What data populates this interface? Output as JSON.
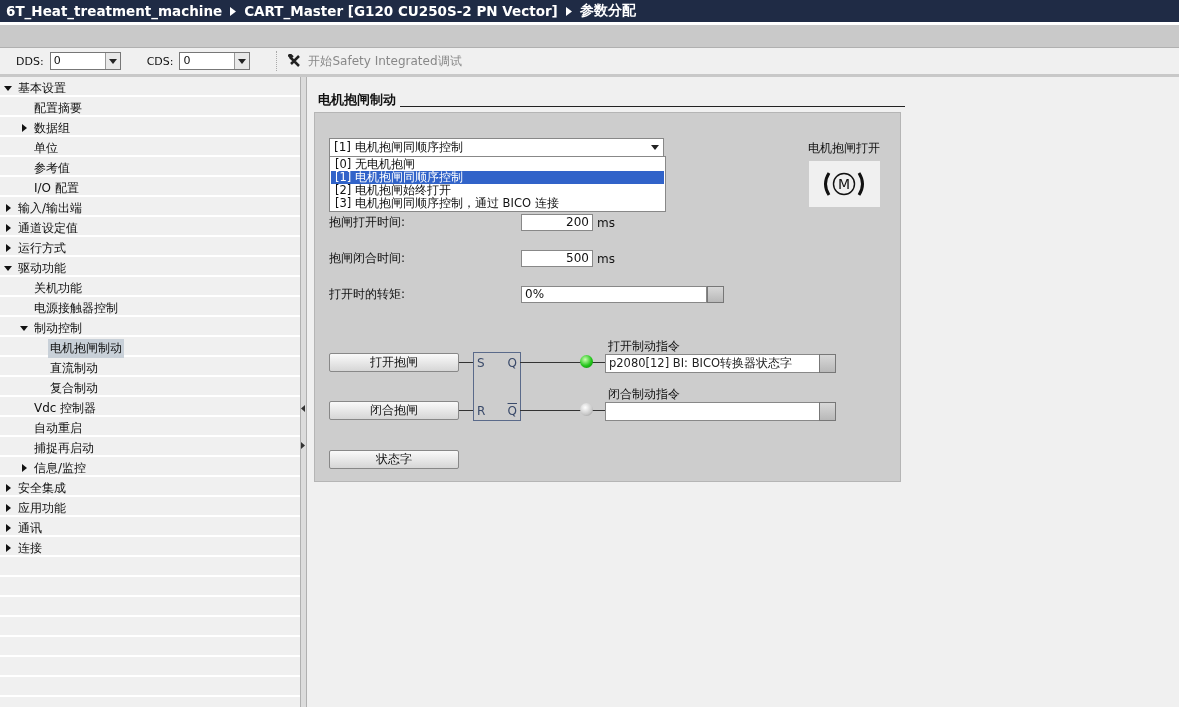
{
  "breadcrumb": [
    "6T_Heat_treatment_machine",
    "CART_Master [G120 CU250S-2 PN Vector]",
    "参数分配"
  ],
  "toolbar": {
    "dds_label": "DDS:",
    "dds_value": "0",
    "cds_label": "CDS:",
    "cds_value": "0",
    "safety_button": "开始Safety Integrated调试",
    "safety_disabled": true
  },
  "tree": [
    {
      "label": "基本设置",
      "expanded": true,
      "selected": false,
      "children": [
        {
          "label": "配置摘要",
          "selected": false
        },
        {
          "label": "数据组",
          "expanded": false,
          "selected": false
        },
        {
          "label": "单位",
          "selected": false
        },
        {
          "label": "参考值",
          "selected": false
        },
        {
          "label": "I/O 配置",
          "selected": false
        }
      ]
    },
    {
      "label": "输入/输出端",
      "expanded": false,
      "selected": false
    },
    {
      "label": "通道设定值",
      "expanded": false,
      "selected": false
    },
    {
      "label": "运行方式",
      "expanded": false,
      "selected": false
    },
    {
      "label": "驱动功能",
      "expanded": true,
      "selected": false,
      "children": [
        {
          "label": "关机功能",
          "selected": false
        },
        {
          "label": "电源接触器控制",
          "selected": false
        },
        {
          "label": "制动控制",
          "expanded": true,
          "selected": false,
          "children": [
            {
              "label": "电机抱闸制动",
              "selected": true
            },
            {
              "label": "直流制动",
              "selected": false
            },
            {
              "label": "复合制动",
              "selected": false
            }
          ]
        },
        {
          "label": "Vdc 控制器",
          "selected": false
        },
        {
          "label": "自动重启",
          "selected": false
        },
        {
          "label": "捕捉再启动",
          "selected": false
        },
        {
          "label": "信息/监控",
          "expanded": false,
          "selected": false
        }
      ]
    },
    {
      "label": "安全集成",
      "expanded": false,
      "selected": false
    },
    {
      "label": "应用功能",
      "expanded": false,
      "selected": false
    },
    {
      "label": "通讯",
      "expanded": false,
      "selected": false
    },
    {
      "label": "连接",
      "expanded": false,
      "selected": false
    }
  ],
  "section_title": "电机抱闸制动",
  "brake_mode": {
    "value": "[1] 电机抱闸同顺序控制",
    "expanded": true,
    "options": [
      {
        "label": "[0] 无电机抱闸",
        "selected": false
      },
      {
        "label": "[1] 电机抱闸同顺序控制",
        "selected": true
      },
      {
        "label": "[2] 电机抱闸始终打开",
        "selected": false
      },
      {
        "label": "[3] 电机抱闸同顺序控制，通过 BICO 连接",
        "selected": false
      }
    ]
  },
  "brake_status": {
    "label": "电机抱闸打开",
    "icon_letter": "M"
  },
  "fields": [
    {
      "label": "抱闸打开时间:",
      "kind": "number",
      "value": "200",
      "unit": "ms"
    },
    {
      "label": "抱闸闭合时间:",
      "kind": "number",
      "value": "500",
      "unit": "ms"
    },
    {
      "label": "打开时的转矩:",
      "kind": "picker",
      "value": "0%"
    }
  ],
  "diagram": {
    "buttons": [
      "打开抱闸",
      "闭合抱闸",
      "状态字"
    ],
    "block": {
      "set": "S",
      "reset": "R",
      "q": "Q",
      "q_not": "Q"
    },
    "outputs": [
      {
        "label": "打开制动指令",
        "value": "p2080[12] BI: BICO转换器状态字",
        "on": true
      },
      {
        "label": "闭合制动指令",
        "on": false
      }
    ]
  }
}
